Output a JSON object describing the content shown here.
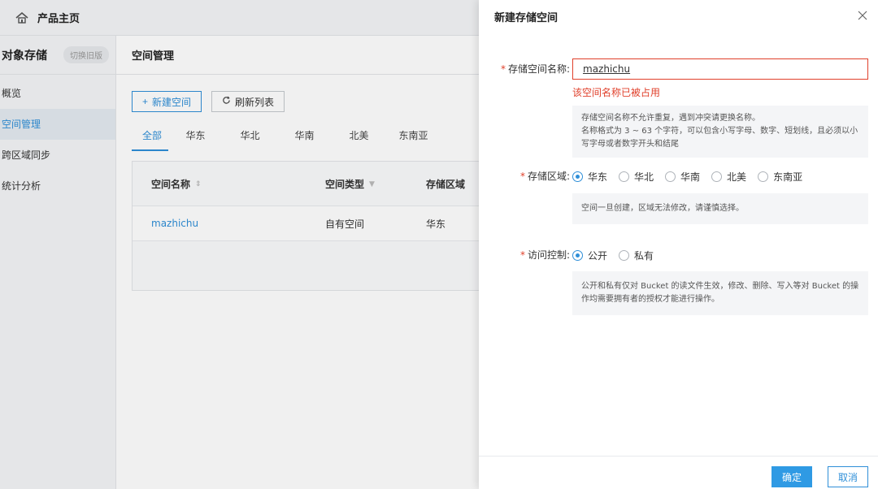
{
  "topbar": {
    "title": "产品主页",
    "icon": "home-icon"
  },
  "sidebar": {
    "title": "对象存储",
    "switch_label": "切换旧版",
    "items": [
      {
        "label": "概览"
      },
      {
        "label": "空间管理"
      },
      {
        "label": "跨区域同步"
      },
      {
        "label": "统计分析"
      }
    ]
  },
  "main": {
    "title": "空间管理",
    "new_button": "新建空间",
    "refresh_button": "刷新列表",
    "tabs": [
      {
        "label": "全部"
      },
      {
        "label": "华东"
      },
      {
        "label": "华北"
      },
      {
        "label": "华南"
      },
      {
        "label": "北美"
      },
      {
        "label": "东南亚"
      }
    ],
    "table": {
      "headers": [
        "空间名称",
        "空间类型",
        "存储区域"
      ],
      "rows": [
        {
          "name": "mazhichu",
          "type": "自有空间",
          "region": "华东"
        }
      ]
    }
  },
  "drawer": {
    "title": "新建存储空间",
    "name_label": "存储空间名称:",
    "name_value": "mazhichu",
    "name_error": "该空间名称已被占用",
    "name_tip_line1": "存储空间名称不允许重复，遇到冲突请更换名称。",
    "name_tip_line2": "名称格式为 3 ~ 63 个字符，可以包含小写字母、数字、短划线，且必须以小写字母或者数字开头和结尾",
    "region_label": "存储区域:",
    "region_options": [
      "华东",
      "华北",
      "华南",
      "北美",
      "东南亚"
    ],
    "region_selected": "华东",
    "region_tip": "空间一旦创建，区域无法修改，请谨慎选择。",
    "access_label": "访问控制:",
    "access_options": [
      "公开",
      "私有"
    ],
    "access_selected": "公开",
    "access_tip": "公开和私有仅对 Bucket 的读文件生效，修改、删除、写入等对 Bucket 的操作均需要拥有者的授权才能进行操作。",
    "confirm_label": "确定",
    "cancel_label": "取消"
  },
  "colors": {
    "accent": "#2f8fd8",
    "error": "#e0402b",
    "primary_button": "#2f9ae4"
  }
}
